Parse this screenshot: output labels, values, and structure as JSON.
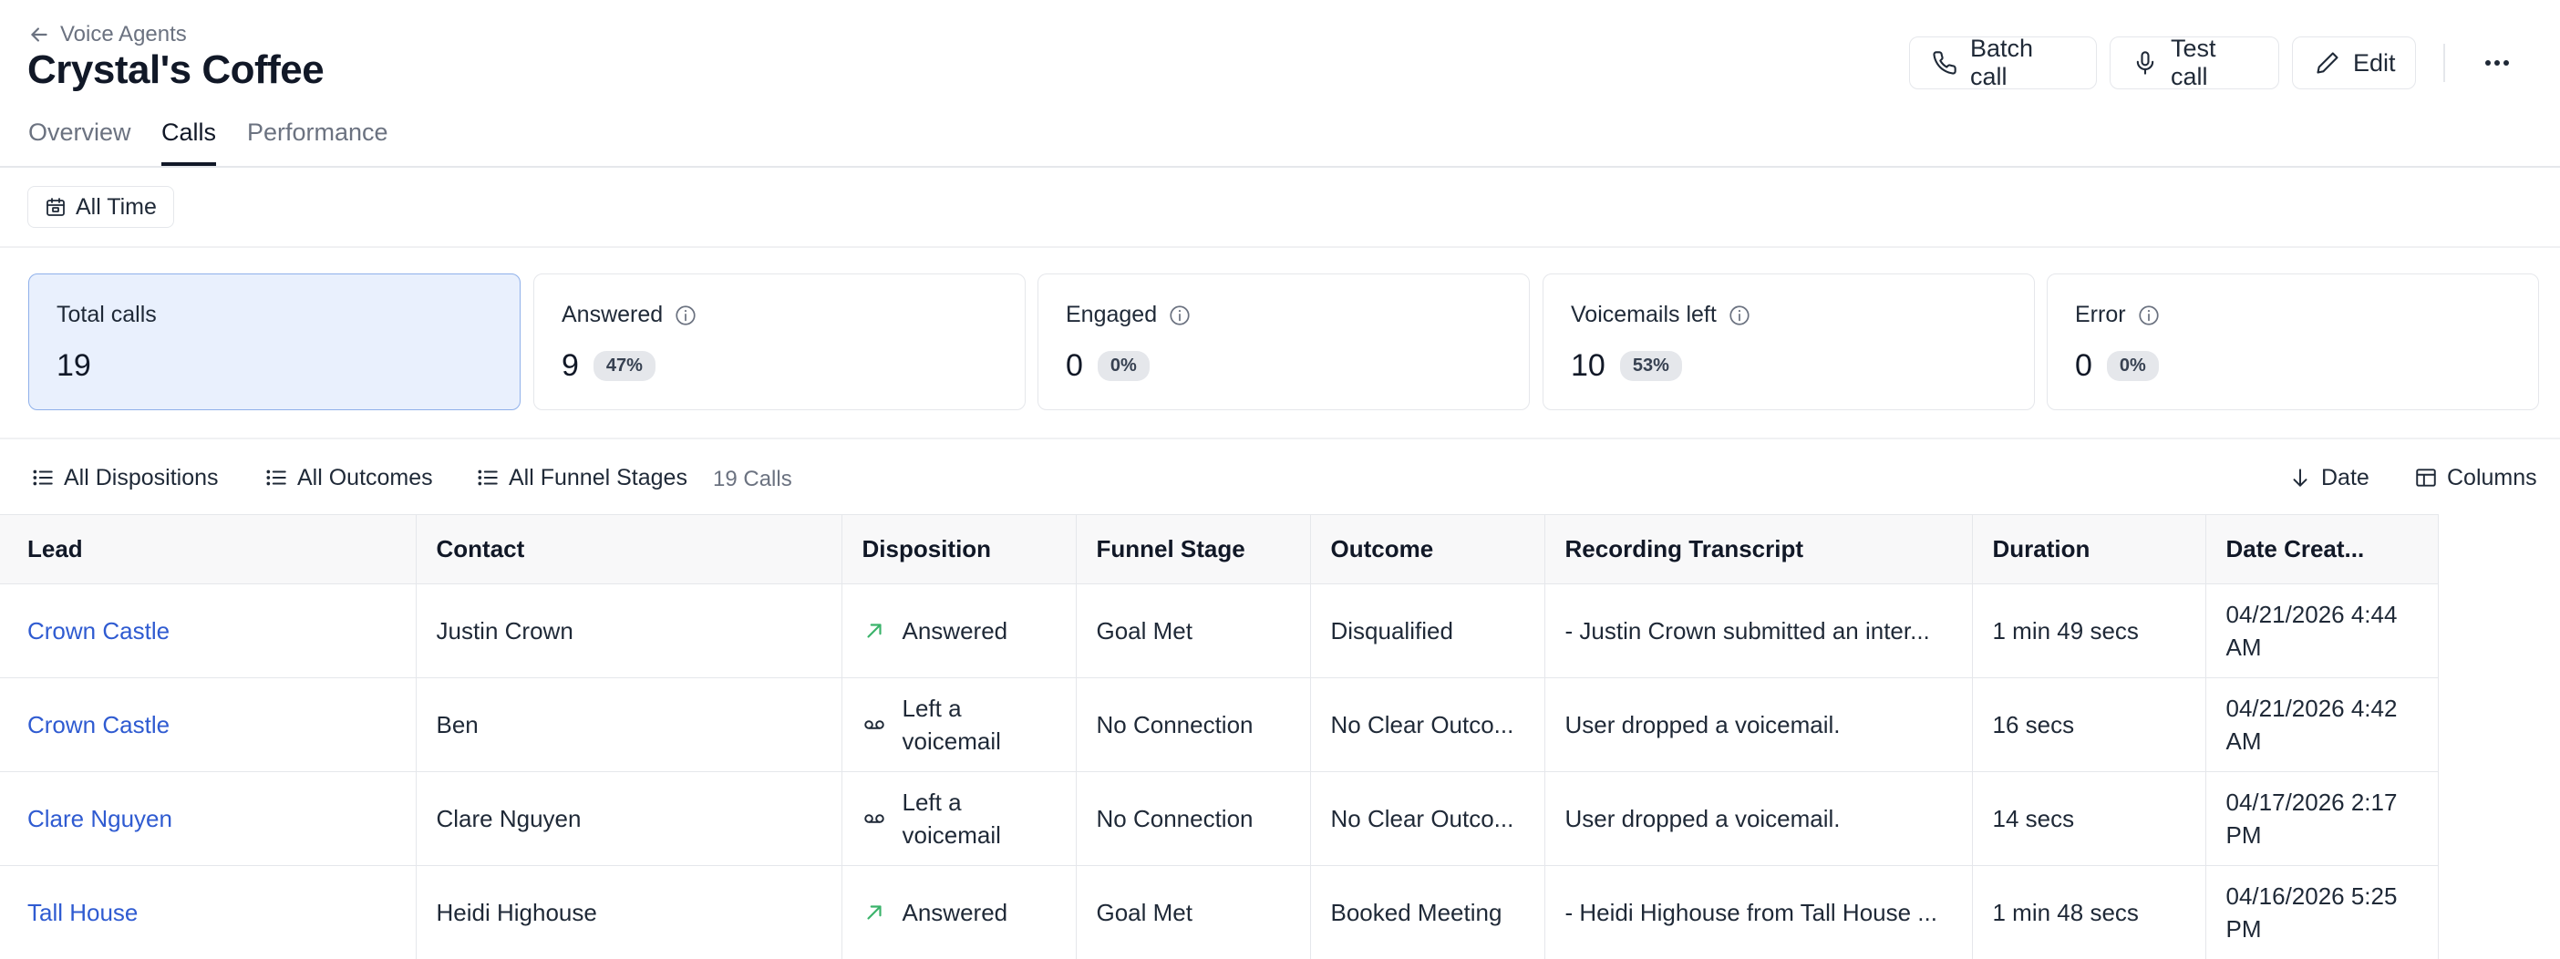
{
  "header": {
    "back_label": "Voice Agents",
    "title": "Crystal's Coffee",
    "actions": {
      "batch_call": "Batch call",
      "test_call": "Test call",
      "edit": "Edit"
    }
  },
  "tabs": [
    "Overview",
    "Calls",
    "Performance"
  ],
  "active_tab": "Calls",
  "time_filter": "All Time",
  "stats": [
    {
      "label": "Total calls",
      "value": "19",
      "pct": ""
    },
    {
      "label": "Answered",
      "value": "9",
      "pct": "47%"
    },
    {
      "label": "Engaged",
      "value": "0",
      "pct": "0%"
    },
    {
      "label": "Voicemails left",
      "value": "10",
      "pct": "53%"
    },
    {
      "label": "Error",
      "value": "0",
      "pct": "0%"
    }
  ],
  "toolbar": {
    "dispositions": "All Dispositions",
    "outcomes": "All Outcomes",
    "funnel_stages": "All Funnel Stages",
    "count": "19 Calls",
    "sort": "Date",
    "columns": "Columns"
  },
  "table": {
    "columns": [
      "Lead",
      "Contact",
      "Disposition",
      "Funnel Stage",
      "Outcome",
      "Recording Transcript",
      "Duration",
      "Date Creat..."
    ],
    "rows": [
      {
        "lead": "Crown Castle",
        "contact": "Justin Crown",
        "disposition": "Answered",
        "disposition_icon": "arrow-up-right-icon",
        "funnel": "Goal Met",
        "outcome": "Disqualified",
        "transcript": "- Justin Crown submitted an inter...",
        "duration": "1 min 49 secs",
        "date": "04/21/2026 4:44 AM"
      },
      {
        "lead": "Crown Castle",
        "contact": "Ben",
        "disposition": "Left a voicemail",
        "disposition_icon": "voicemail-icon",
        "funnel": "No Connection",
        "outcome": "No Clear Outco...",
        "transcript": "User dropped a voicemail.",
        "duration": "16 secs",
        "date": "04/21/2026 4:42 AM"
      },
      {
        "lead": "Clare Nguyen",
        "contact": "Clare Nguyen",
        "disposition": "Left a voicemail",
        "disposition_icon": "voicemail-icon",
        "funnel": "No Connection",
        "outcome": "No Clear Outco...",
        "transcript": "User dropped a voicemail.",
        "duration": "14 secs",
        "date": "04/17/2026 2:17 PM"
      },
      {
        "lead": "Tall House",
        "contact": "Heidi Highouse",
        "disposition": "Answered",
        "disposition_icon": "arrow-up-right-icon",
        "funnel": "Goal Met",
        "outcome": "Booked Meeting",
        "transcript": "- Heidi Highouse from Tall House ...",
        "duration": "1 min 48 secs",
        "date": "04/16/2026 5:25 PM"
      }
    ]
  },
  "colors": {
    "link": "#2f5bd1",
    "answered_icon": "#3bb36b",
    "selected_card_bg": "#e9f0fd",
    "selected_card_border": "#8fb0ea"
  }
}
